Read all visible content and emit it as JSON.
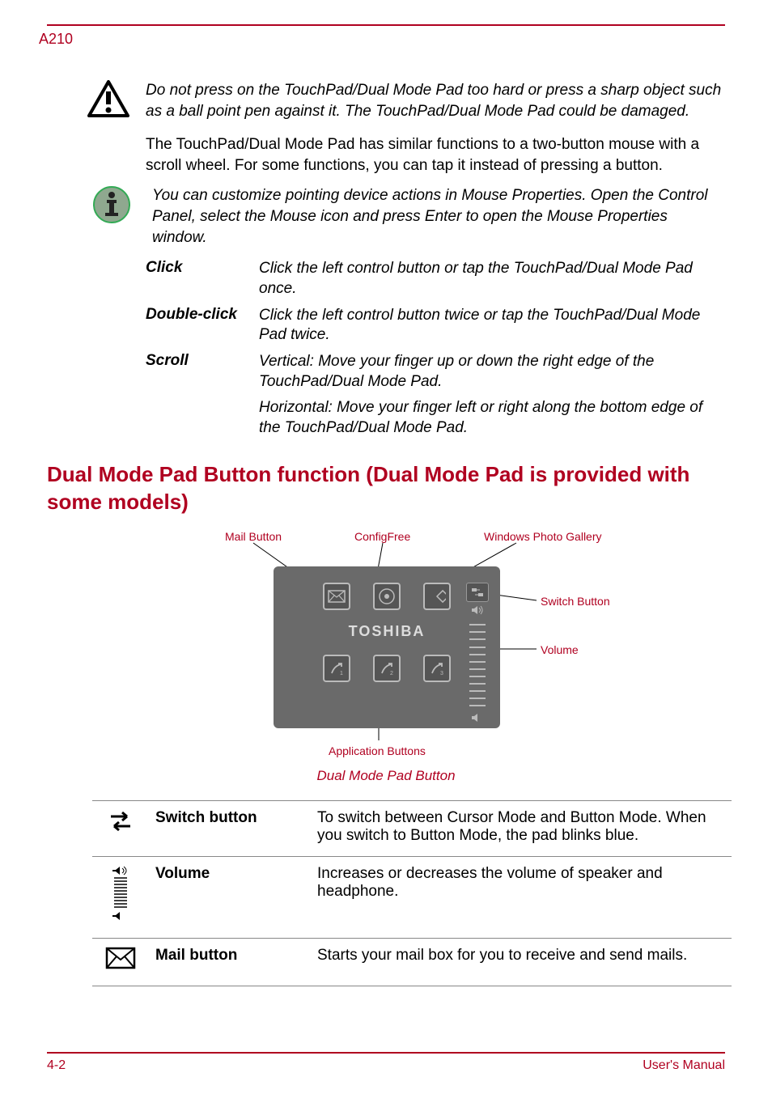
{
  "header": {
    "model": "A210"
  },
  "warning": {
    "text": "Do not press on the TouchPad/Dual Mode Pad too hard or press a sharp object such as a ball point pen against it. The TouchPad/Dual Mode Pad could be damaged."
  },
  "intro_paragraph": "The TouchPad/Dual Mode Pad has similar functions to a two-button mouse with a scroll wheel. For some functions, you can tap it instead of pressing a button.",
  "note": {
    "text": "You can customize pointing device actions in Mouse Properties. Open the Control Panel, select the Mouse icon and press Enter to open the Mouse Properties window."
  },
  "actions": {
    "click": {
      "term": "Click",
      "desc": "Click the left control button or tap the TouchPad/Dual Mode Pad once."
    },
    "double_click": {
      "term": "Double-click",
      "desc": "Click the left control button twice or tap the TouchPad/Dual Mode Pad twice."
    },
    "scroll": {
      "term": "Scroll",
      "desc": "Vertical: Move your finger up or down the right edge of the TouchPad/Dual Mode Pad.",
      "extra": "Horizontal: Move your finger left or right along the bottom edge of the TouchPad/Dual Mode Pad."
    }
  },
  "section_heading": "Dual Mode Pad Button function (Dual Mode Pad is provided with some models)",
  "diagram": {
    "labels": {
      "mail": "Mail Button",
      "configfree": "ConfigFree",
      "gallery": "Windows Photo Gallery",
      "switch": "Switch Button",
      "volume": "Volume",
      "apps": "Application Buttons"
    },
    "logo": "TOSHIBA",
    "caption": "Dual Mode Pad Button"
  },
  "functions": {
    "switch": {
      "term": "Switch button",
      "desc": "To switch between Cursor Mode and Button Mode. When you switch to Button Mode, the pad blinks blue."
    },
    "volume": {
      "term": "Volume",
      "desc": "Increases or decreases the volume of speaker and headphone."
    },
    "mail": {
      "term": "Mail button",
      "desc": "Starts your mail box for you to receive and send mails."
    }
  },
  "footer": {
    "page": "4-2",
    "manual": "User's Manual"
  }
}
